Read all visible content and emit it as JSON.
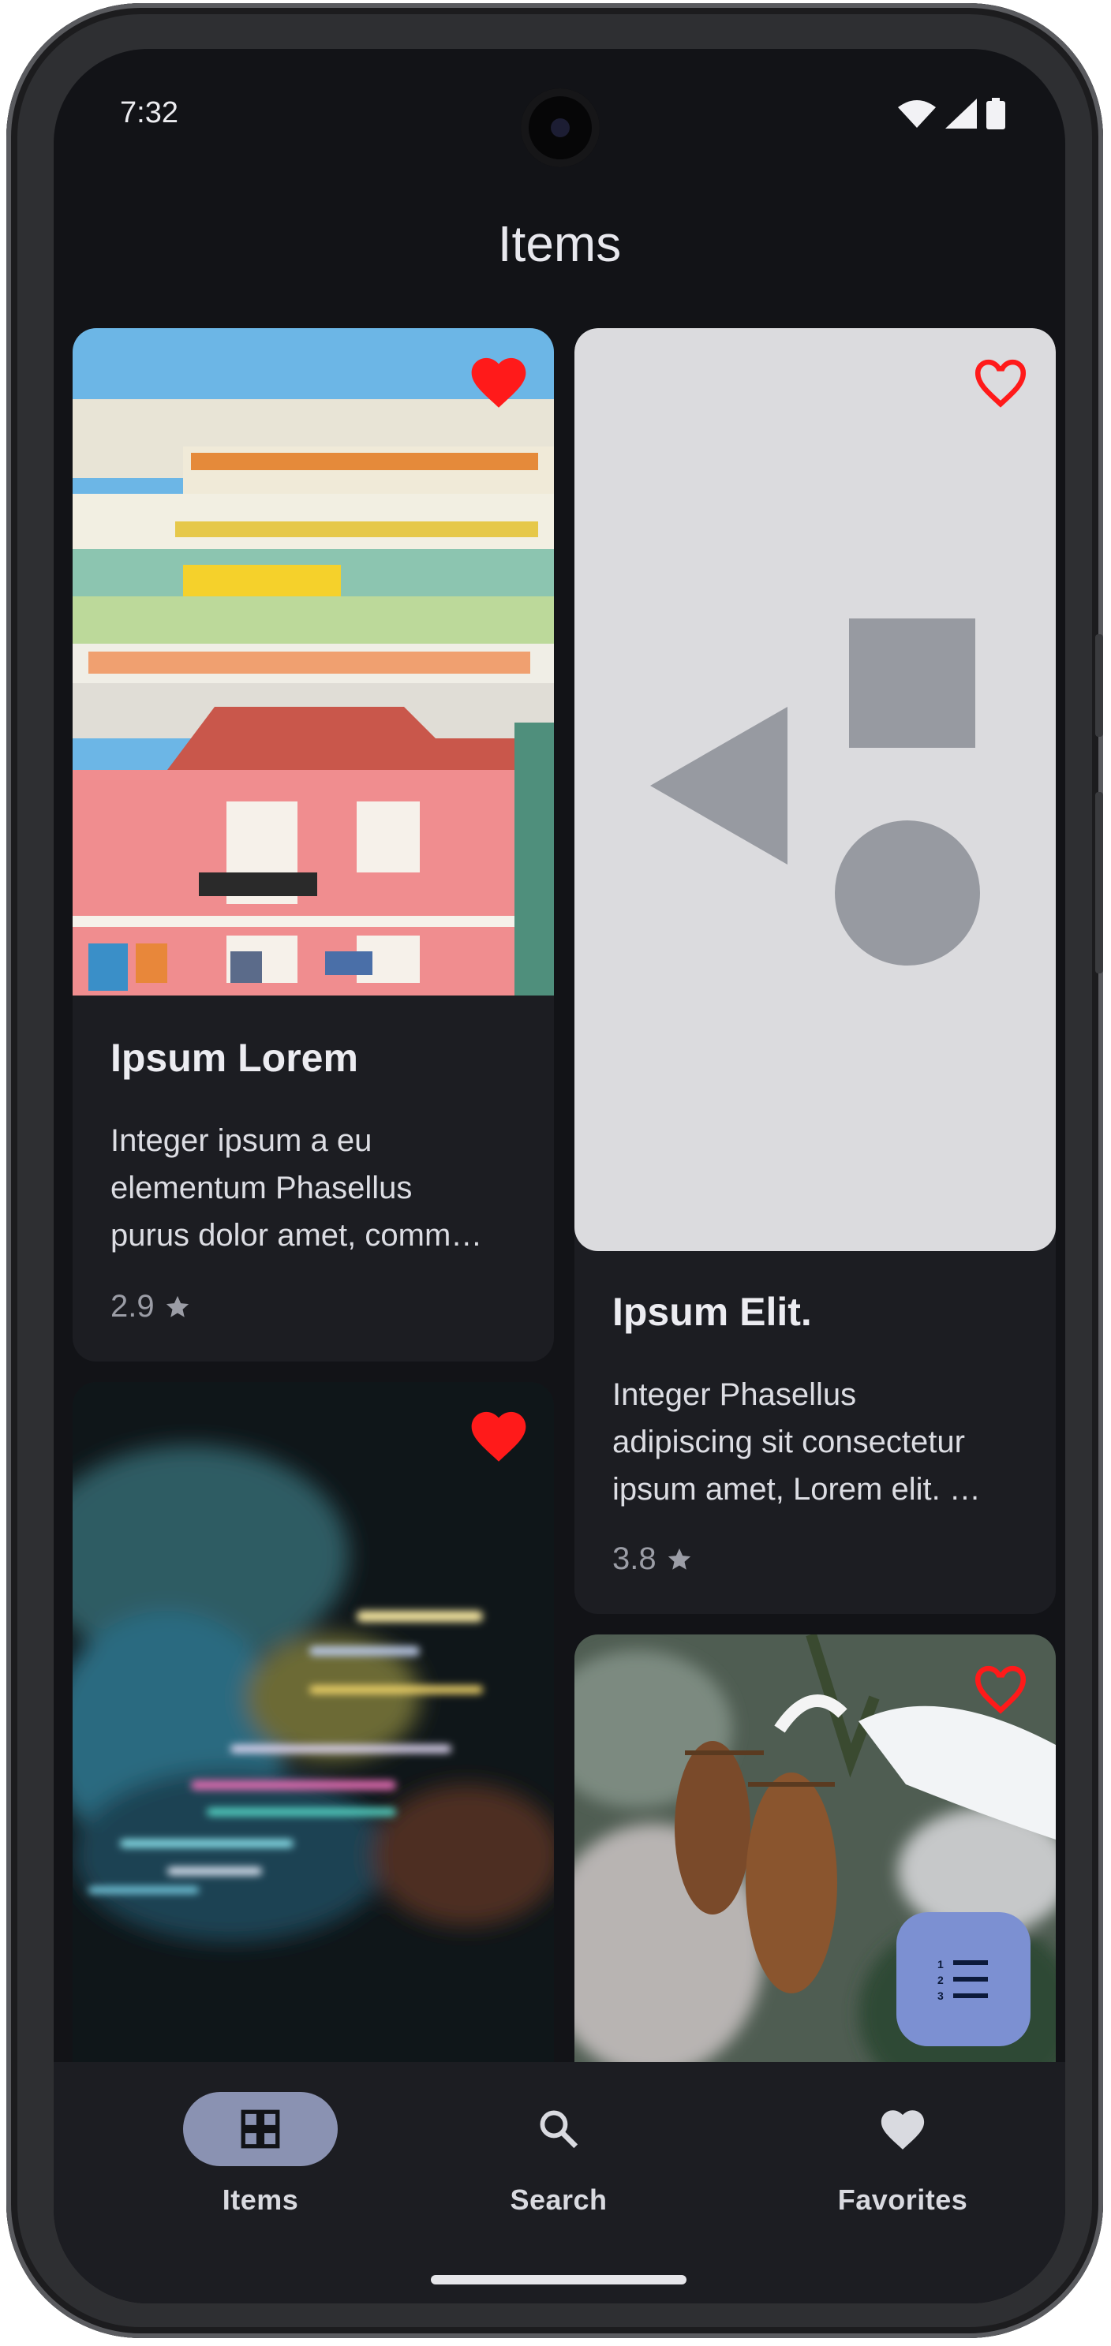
{
  "status_bar": {
    "time": "7:32"
  },
  "app_bar": {
    "title": "Items"
  },
  "cards": [
    {
      "title": "Ipsum Lorem",
      "desc_lines": [
        "Integer ipsum a eu",
        "elementum Phasellus",
        "purus dolor amet, comm…"
      ],
      "rating": "2.9",
      "favorite": true,
      "image": "colorful-building-photo"
    },
    {
      "title": "Ipsum Elit.",
      "desc_lines": [
        "Integer Phasellus",
        "adipiscing sit consectetur",
        "ipsum amet, Lorem elit. …"
      ],
      "rating": "3.8",
      "favorite": false,
      "image": "placeholder-shapes"
    },
    {
      "favorite": true,
      "image": "blurred-lights-photo"
    },
    {
      "favorite": false,
      "image": "snowy-pinecone-photo"
    }
  ],
  "fab": {
    "icon": "sort-list-icon"
  },
  "nav": {
    "items": [
      {
        "label": "Items",
        "icon": "grid-icon",
        "active": true
      },
      {
        "label": "Search",
        "icon": "search-icon",
        "active": false
      },
      {
        "label": "Favorites",
        "icon": "heart-icon",
        "active": false
      }
    ]
  },
  "colors": {
    "background": "#121317",
    "card": "#1c1d22",
    "favorite": "#ff1a1a",
    "fab": "#7c90d2",
    "nav_active": "#8a92b2"
  }
}
